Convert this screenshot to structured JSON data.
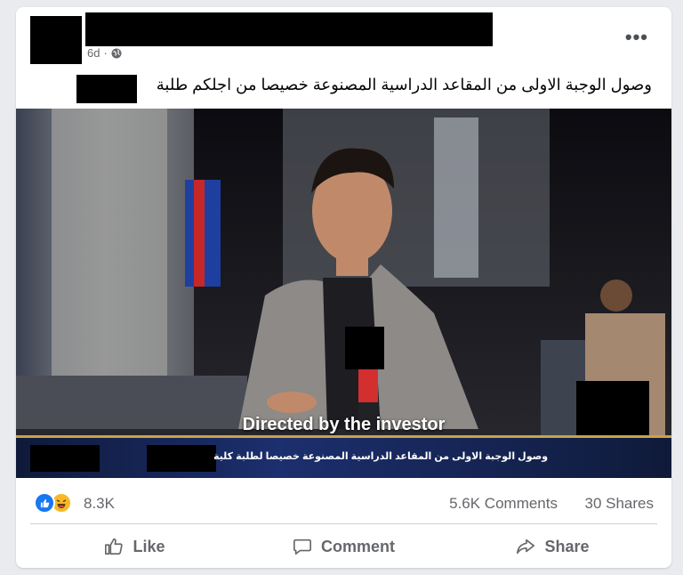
{
  "post": {
    "time": "6d",
    "separator": "·",
    "text": "وصول الوجبة الاولى من المقاعد الدراسية المصنوعة خصيصا من اجلكم طلبة"
  },
  "video": {
    "caption": "Directed by the investor",
    "ticker": "وصول الوجبة الاولى من المقاعد الدراسية المصنوعة خصيصا لطلبة كلية"
  },
  "stats": {
    "reactions_count": "8.3K",
    "comments": "5.6K Comments",
    "shares": "30 Shares",
    "reaction_icons": [
      "like-icon",
      "haha-icon"
    ]
  },
  "actions": {
    "like": "Like",
    "comment": "Comment",
    "share": "Share"
  },
  "colors": {
    "like_blue": "#1877f2",
    "haha_yellow": "#f7b928",
    "ticker_navy": "#1c2f6e",
    "ticker_gold": "#c9a24a"
  }
}
